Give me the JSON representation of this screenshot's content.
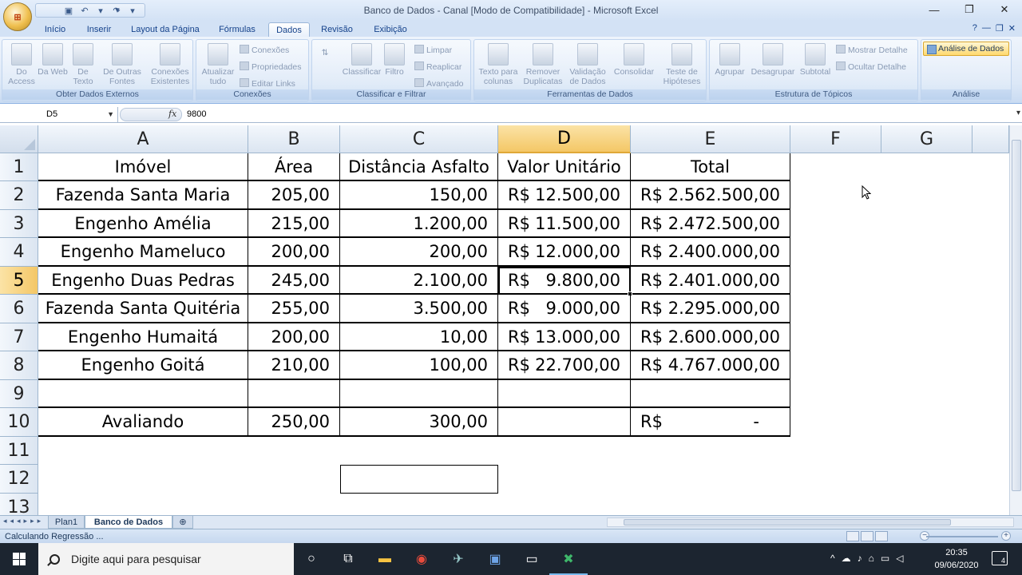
{
  "window": {
    "title": "Banco de Dados - Canal  [Modo de Compatibilidade] - Microsoft Excel"
  },
  "ribbon_tabs": [
    "Início",
    "Inserir",
    "Layout da Página",
    "Fórmulas",
    "Dados",
    "Revisão",
    "Exibição"
  ],
  "active_tab": "Dados",
  "ribbon": {
    "groups": {
      "obter": "Obter Dados Externos",
      "conexoes": "Conexões",
      "classificar": "Classificar e Filtrar",
      "ferramentas": "Ferramentas de Dados",
      "estrutura": "Estrutura de Tópicos",
      "analise": "Análise"
    },
    "buttons": {
      "do_access": "Do Access",
      "da_web": "Da Web",
      "de_texto": "De Texto",
      "de_outras_fontes": "De Outras Fontes",
      "conexoes_existentes": "Conexões Existentes",
      "atualizar_tudo": "Atualizar tudo",
      "conexoes": "Conexões",
      "propriedades": "Propriedades",
      "editar_links": "Editar Links",
      "classificar": "Classificar",
      "filtro": "Filtro",
      "limpar": "Limpar",
      "reaplicar": "Reaplicar",
      "avancado": "Avançado",
      "texto_para_colunas": "Texto para colunas",
      "remover_duplicatas": "Remover Duplicatas",
      "validacao_de_dados": "Validação de Dados",
      "consolidar": "Consolidar",
      "teste_de_hipoteses": "Teste de Hipóteses",
      "agrupar": "Agrupar",
      "desagrupar": "Desagrupar",
      "subtotal": "Subtotal",
      "mostrar_detalhe": "Mostrar Detalhe",
      "ocultar_detalhe": "Ocultar Detalhe",
      "analise_de_dados": "Análise de Dados"
    }
  },
  "formula_bar": {
    "name_box": "D5",
    "fx": "fx",
    "value": "9800"
  },
  "columns": [
    "A",
    "B",
    "C",
    "D",
    "E",
    "F",
    "G"
  ],
  "rows": [
    "1",
    "2",
    "3",
    "4",
    "5",
    "6",
    "7",
    "8",
    "9",
    "10",
    "11",
    "12",
    "13"
  ],
  "table": {
    "headers": [
      "Imóvel",
      "Área",
      "Distância Asfalto",
      "Valor Unitário",
      "Total"
    ],
    "data": [
      {
        "a": "Fazenda Santa Maria",
        "b": "205,00",
        "c": "150,00",
        "d_cur": "R$",
        "d_val": "12.500,00",
        "e_cur": "R$",
        "e_val": "2.562.500,00"
      },
      {
        "a": "Engenho Amélia",
        "b": "215,00",
        "c": "1.200,00",
        "d_cur": "R$",
        "d_val": "11.500,00",
        "e_cur": "R$",
        "e_val": "2.472.500,00"
      },
      {
        "a": "Engenho Mameluco",
        "b": "200,00",
        "c": "200,00",
        "d_cur": "R$",
        "d_val": "12.000,00",
        "e_cur": "R$",
        "e_val": "2.400.000,00"
      },
      {
        "a": "Engenho Duas Pedras",
        "b": "245,00",
        "c": "2.100,00",
        "d_cur": "R$",
        "d_val": "9.800,00",
        "e_cur": "R$",
        "e_val": "2.401.000,00"
      },
      {
        "a": "Fazenda Santa Quitéria",
        "b": "255,00",
        "c": "3.500,00",
        "d_cur": "R$",
        "d_val": "9.000,00",
        "e_cur": "R$",
        "e_val": "2.295.000,00"
      },
      {
        "a": "Engenho Humaitá",
        "b": "200,00",
        "c": "10,00",
        "d_cur": "R$",
        "d_val": "13.000,00",
        "e_cur": "R$",
        "e_val": "2.600.000,00"
      },
      {
        "a": "Engenho Goitá",
        "b": "210,00",
        "c": "100,00",
        "d_cur": "R$",
        "d_val": "22.700,00",
        "e_cur": "R$",
        "e_val": "4.767.000,00"
      }
    ],
    "avaliando": {
      "a": "Avaliando",
      "b": "250,00",
      "c": "300,00",
      "e_cur": "R$",
      "e_val": "-"
    }
  },
  "sheets": [
    "Plan1",
    "Banco de Dados"
  ],
  "active_sheet": "Banco de Dados",
  "status": {
    "text": "Calculando Regressão ..."
  },
  "taskbar": {
    "search_placeholder": "Digite aqui para pesquisar",
    "time": "20:35",
    "date": "09/06/2020",
    "notifications": "4"
  }
}
